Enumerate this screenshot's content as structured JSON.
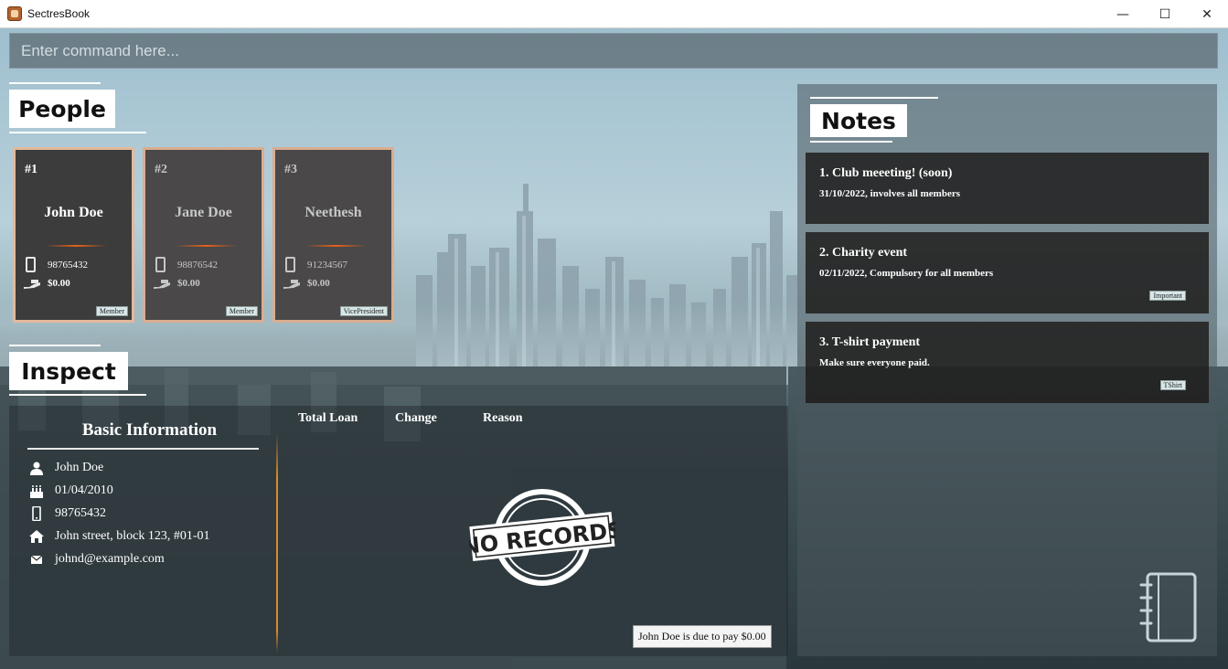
{
  "window": {
    "title": "SectresBook",
    "minimize": "—",
    "maximize": "☐",
    "close": "✕"
  },
  "command": {
    "placeholder": "Enter command here..."
  },
  "people": {
    "heading": "People",
    "cards": [
      {
        "index": "#1",
        "name": "John Doe",
        "phone": "98765432",
        "debt": "$0.00",
        "tag": "Member"
      },
      {
        "index": "#2",
        "name": "Jane Doe",
        "phone": "98876542",
        "debt": "$0.00",
        "tag": "Member"
      },
      {
        "index": "#3",
        "name": "Neethesh",
        "phone": "91234567",
        "debt": "$0.00",
        "tag": "VicePresident"
      }
    ]
  },
  "inspect": {
    "heading": "Inspect",
    "basic_title": "Basic Information",
    "name": "John Doe",
    "birthday": "01/04/2010",
    "phone": "98765432",
    "address": "John street, block 123, #01-01",
    "email": "johnd@example.com",
    "columns": [
      "Total Loan",
      "Change",
      "Reason"
    ],
    "stamp_text": "NO RECORDS",
    "due_text": "John Doe is due to pay $0.00"
  },
  "notes": {
    "heading": "Notes",
    "items": [
      {
        "title": "1.  Club meeeting! (soon)",
        "desc": "31/10/2022, involves all members",
        "tag": ""
      },
      {
        "title": "2.  Charity event",
        "desc": "02/11/2022, Compulsory for all members",
        "tag": "Important"
      },
      {
        "title": "3.  T-shirt payment",
        "desc": "Make sure everyone paid.",
        "tag": "TShirt"
      }
    ]
  },
  "colors": {
    "card_border": "#e4b89a",
    "separator": "#e6611a",
    "inspect_divider": "#d98c28"
  }
}
